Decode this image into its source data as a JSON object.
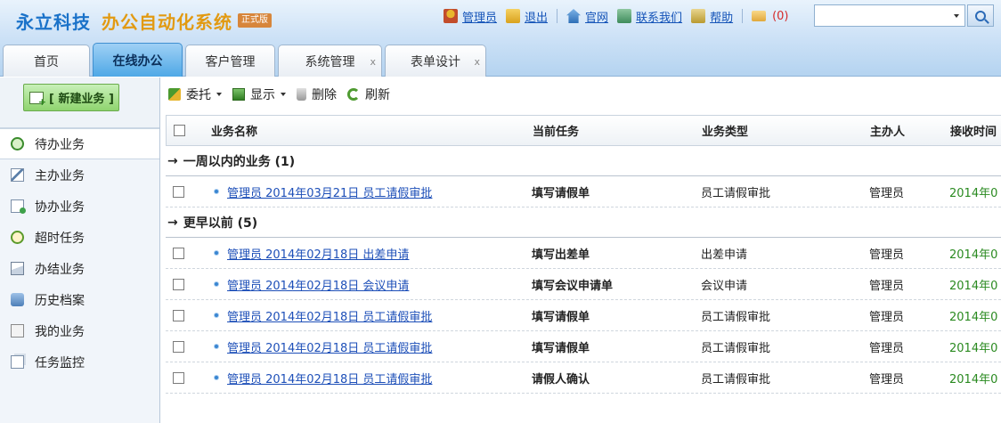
{
  "header": {
    "brand": "永立科技",
    "system_name": "办公自动化系统",
    "edition_badge": "正式版",
    "links": {
      "admin": "管理员",
      "logout": "退出",
      "website": "官网",
      "contact": "联系我们",
      "help": "帮助"
    },
    "mail_count": "(0)",
    "search_value": ""
  },
  "tabs": [
    {
      "label": "首页",
      "active": false,
      "closable": false
    },
    {
      "label": "在线办公",
      "active": true,
      "closable": false
    },
    {
      "label": "客户管理",
      "active": false,
      "closable": false
    },
    {
      "label": "系统管理",
      "active": false,
      "closable": true
    },
    {
      "label": "表单设计",
      "active": false,
      "closable": true
    }
  ],
  "tab_close": "x",
  "sidebar": {
    "new_button": "[ 新建业务 ]",
    "items": [
      {
        "label": "待办业务",
        "icon": "clock-icon"
      },
      {
        "label": "主办业务",
        "icon": "edit-icon"
      },
      {
        "label": "协办业务",
        "icon": "document-icon"
      },
      {
        "label": "超时任务",
        "icon": "alarm-icon"
      },
      {
        "label": "办结业务",
        "icon": "mail-icon"
      },
      {
        "label": "历史档案",
        "icon": "archive-icon"
      },
      {
        "label": "我的业务",
        "icon": "my-file-icon"
      },
      {
        "label": "任务监控",
        "icon": "monitor-icon"
      }
    ]
  },
  "toolbar": {
    "delegate": "委托",
    "display": "显示",
    "delete": "删除",
    "refresh": "刷新"
  },
  "table": {
    "columns": {
      "name": "业务名称",
      "task": "当前任务",
      "type": "业务类型",
      "owner": "主办人",
      "time": "接收时间"
    },
    "groups": [
      {
        "title": "一周以内的业务 (1)",
        "rows": [
          {
            "name": "管理员 2014年03月21日 员工请假审批",
            "task": "填写请假单",
            "type": "员工请假审批",
            "owner": "管理员",
            "time": "2014年0"
          }
        ]
      },
      {
        "title": "更早以前 (5)",
        "rows": [
          {
            "name": "管理员 2014年02月18日 出差申请",
            "task": "填写出差单",
            "type": "出差申请",
            "owner": "管理员",
            "time": "2014年0"
          },
          {
            "name": "管理员 2014年02月18日 会议申请",
            "task": "填写会议申请单",
            "type": "会议申请",
            "owner": "管理员",
            "time": "2014年0"
          },
          {
            "name": "管理员 2014年02月18日 员工请假审批",
            "task": "填写请假单",
            "type": "员工请假审批",
            "owner": "管理员",
            "time": "2014年0"
          },
          {
            "name": "管理员 2014年02月18日 员工请假审批",
            "task": "填写请假单",
            "type": "员工请假审批",
            "owner": "管理员",
            "time": "2014年0"
          },
          {
            "name": "管理员 2014年02月18日 员工请假审批",
            "task": "请假人确认",
            "type": "员工请假审批",
            "owner": "管理员",
            "time": "2014年0"
          }
        ]
      }
    ]
  }
}
